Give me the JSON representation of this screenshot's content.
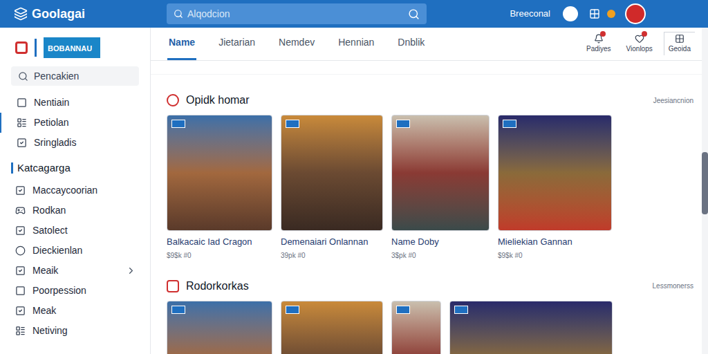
{
  "app": {
    "name": "Goolagai"
  },
  "search": {
    "placeholder": "Alqodcion"
  },
  "user": {
    "name": "Breeconal"
  },
  "sidebar": {
    "brand": "BOBANNAU",
    "search": "Pencakien",
    "items": [
      {
        "label": "Nentiain",
        "selected": false
      },
      {
        "label": "Petiolan",
        "selected": true
      },
      {
        "label": "Sringladis",
        "selected": false
      }
    ],
    "section": "Katcagarga",
    "categories": [
      {
        "label": "Maccaycoorian",
        "submenu": false
      },
      {
        "label": "Rodkan",
        "submenu": false
      },
      {
        "label": "Satolect",
        "submenu": false
      },
      {
        "label": "Dieckienlan",
        "submenu": false
      },
      {
        "label": "Meaik",
        "submenu": true
      },
      {
        "label": "Poorpession",
        "submenu": false
      },
      {
        "label": "Meak",
        "submenu": false
      },
      {
        "label": "Netiving",
        "submenu": false
      }
    ]
  },
  "tabs": [
    {
      "label": "Name",
      "selected": true
    },
    {
      "label": "Jietarian",
      "selected": false
    },
    {
      "label": "Nemdev",
      "selected": false
    },
    {
      "label": "Hennian",
      "selected": false
    },
    {
      "label": "Dnblik",
      "selected": false
    }
  ],
  "actions": [
    {
      "label": "Padiyes",
      "badge": true,
      "boxed": false
    },
    {
      "label": "Vionlops",
      "badge": true,
      "boxed": false
    },
    {
      "label": "Geoida",
      "badge": false,
      "boxed": true
    }
  ],
  "sections": [
    {
      "title": "Opidk homar",
      "link": "Jeesiancnion",
      "cards": [
        {
          "title": "Balkacaic Iad Cragon",
          "price": "$9$k #0"
        },
        {
          "title": "Demenaiari Onlannan",
          "price": "39pk #0"
        },
        {
          "title": "Name Doby",
          "price": "3$pk #0"
        },
        {
          "title": "Mieliekian Gannan",
          "price": "$9$k #0"
        }
      ]
    },
    {
      "title": "Rodorkorkas",
      "link": "Lessmonerss",
      "cards": [
        {
          "title": "",
          "price": ""
        },
        {
          "title": "",
          "price": ""
        },
        {
          "title": "",
          "price": ""
        },
        {
          "title": "",
          "price": ""
        }
      ]
    }
  ]
}
